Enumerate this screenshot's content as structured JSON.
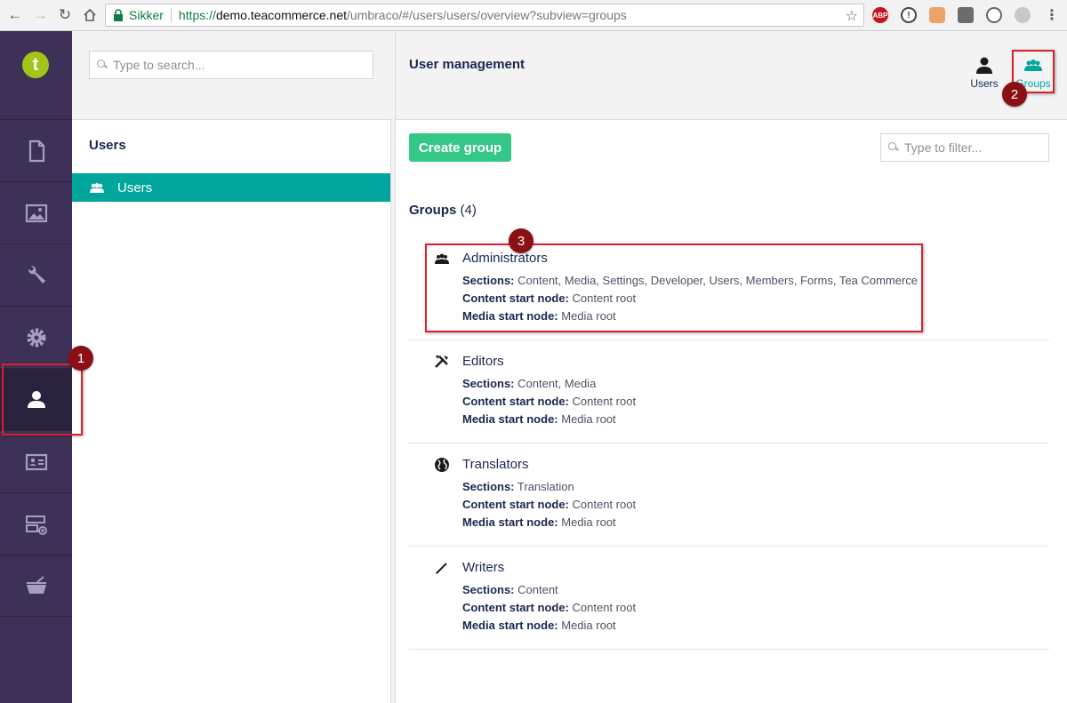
{
  "browser": {
    "secure_label": "Sikker",
    "url_scheme": "https://",
    "url_host": "demo.teacommerce.net",
    "url_path": "/umbraco/#/users/users/overview?subview=groups",
    "ext_abp": "ABP"
  },
  "app": {
    "logo_letter": "t",
    "sections": [
      "content",
      "media",
      "settings",
      "developer",
      "users",
      "members",
      "forms",
      "tea-commerce"
    ],
    "active_section": "users"
  },
  "tree": {
    "search_placeholder": "Type to search...",
    "title": "Users",
    "node_label": "Users"
  },
  "main": {
    "title": "User management",
    "subviews": [
      {
        "label": "Users"
      },
      {
        "label": "Groups",
        "active": true
      }
    ],
    "create_label": "Create group",
    "filter_placeholder": "Type to filter...",
    "groups_heading": "Groups",
    "groups_count": "(4)",
    "labels": {
      "sections": "Sections:",
      "content_start": "Content start node:",
      "media_start": "Media start node:"
    },
    "groups": [
      {
        "name": "Administrators",
        "icon": "users-icon",
        "sections": "Content, Media, Settings, Developer, Users, Members, Forms, Tea Commerce",
        "content_start": "Content root",
        "media_start": "Media root"
      },
      {
        "name": "Editors",
        "icon": "tools-icon",
        "sections": "Content, Media",
        "content_start": "Content root",
        "media_start": "Media root"
      },
      {
        "name": "Translators",
        "icon": "globe-icon",
        "sections": "Translation",
        "content_start": "Content root",
        "media_start": "Media root"
      },
      {
        "name": "Writers",
        "icon": "pencil-icon",
        "sections": "Content",
        "content_start": "Content root",
        "media_start": "Media root"
      }
    ]
  },
  "annotations": [
    "1",
    "2",
    "3"
  ],
  "colors": {
    "sidebar": "#3e3158",
    "accent": "#00a69c",
    "create_button": "#35c786",
    "annotation": "#d9222a"
  }
}
